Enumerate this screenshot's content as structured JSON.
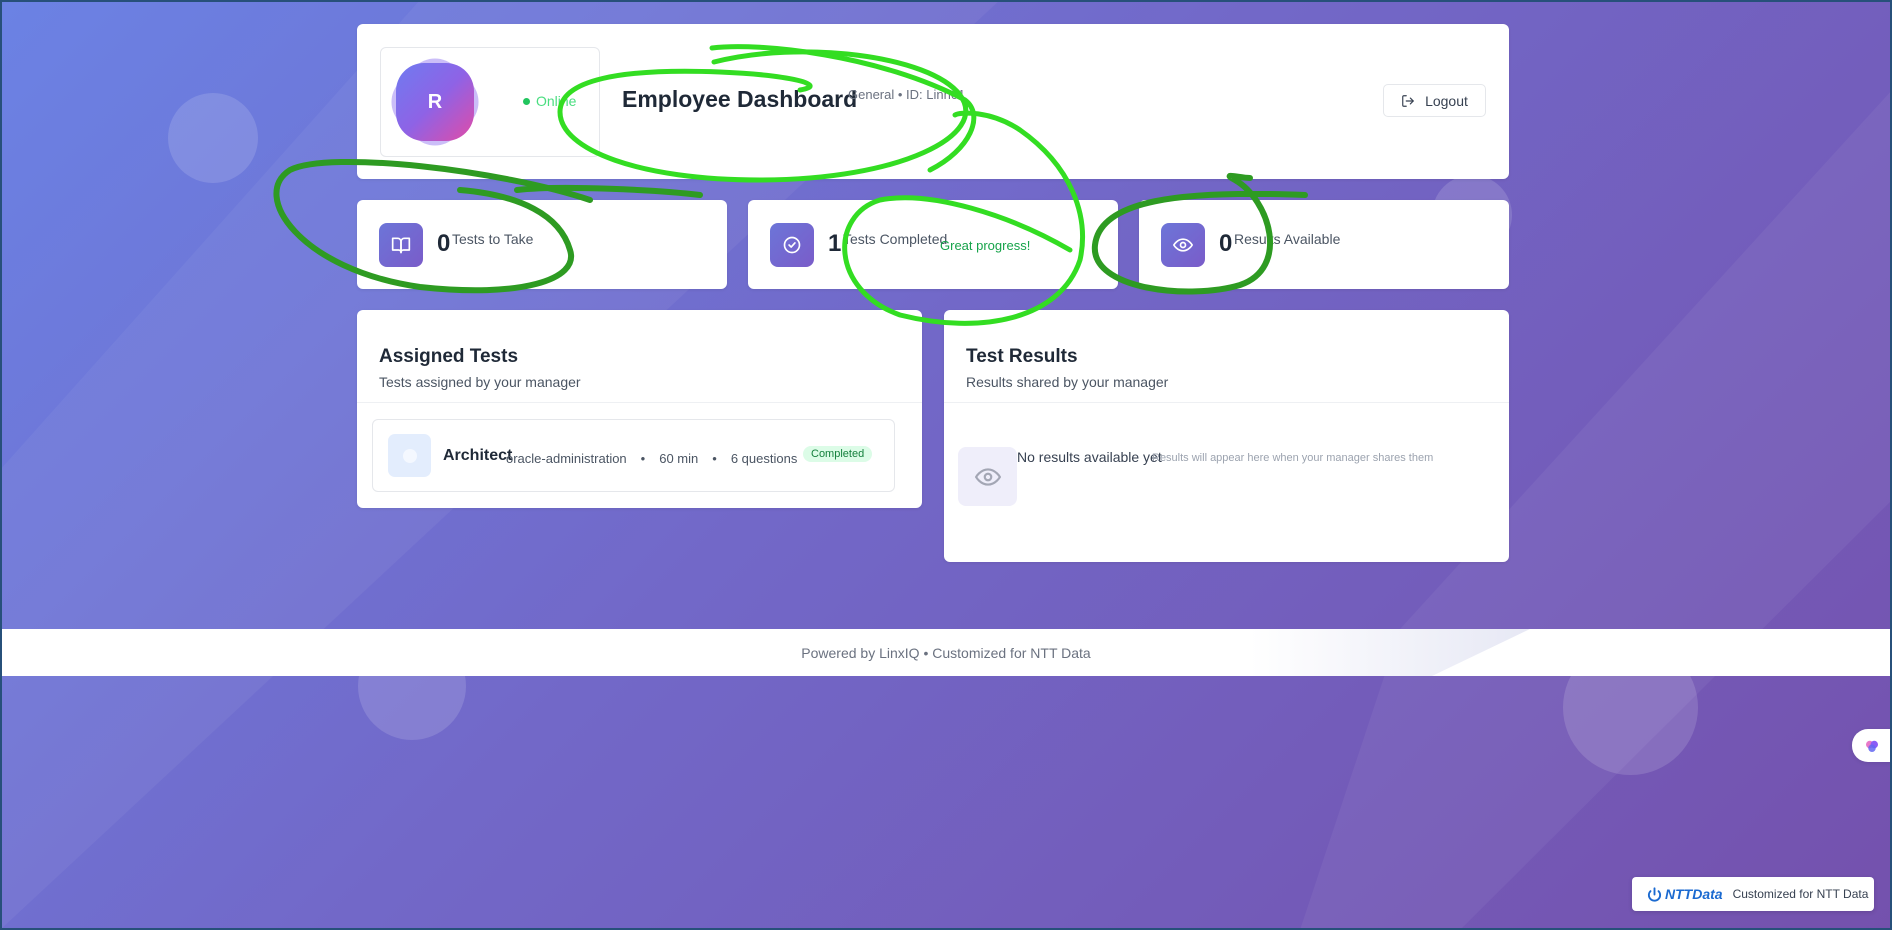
{
  "header": {
    "avatar_letter": "R",
    "status": "Online",
    "title": "Employee Dashboard",
    "subtitle": "General • ID: Linn01",
    "logout_label": "Logout"
  },
  "stats": [
    {
      "icon": "book-open-icon",
      "value": "0",
      "label": "Tests to Take",
      "extra": ""
    },
    {
      "icon": "check-circle-icon",
      "value": "1",
      "label": "Tests Completed",
      "extra": "Great progress!"
    },
    {
      "icon": "eye-icon",
      "value": "0",
      "label": "Results Available",
      "extra": ""
    }
  ],
  "assigned": {
    "title": "Assigned Tests",
    "subtitle": "Tests assigned by your manager",
    "items": [
      {
        "name": "Architect",
        "category": "oracle-administration",
        "duration": "60 min",
        "questions": "6 questions",
        "status": "Completed"
      }
    ]
  },
  "results": {
    "title": "Test Results",
    "subtitle": "Results shared by your manager",
    "empty_title": "No results available yet",
    "empty_sub": "Results will appear here when your manager shares them"
  },
  "footer": {
    "text": "Powered by LinxIQ • Customized for NTT Data"
  },
  "ntt_badge": {
    "logo": "NTTData",
    "text": "Customized for NTT Data"
  },
  "colors": {
    "accent": "#7a5cc9",
    "success": "#16a34a",
    "annotation": "#33dd22"
  }
}
